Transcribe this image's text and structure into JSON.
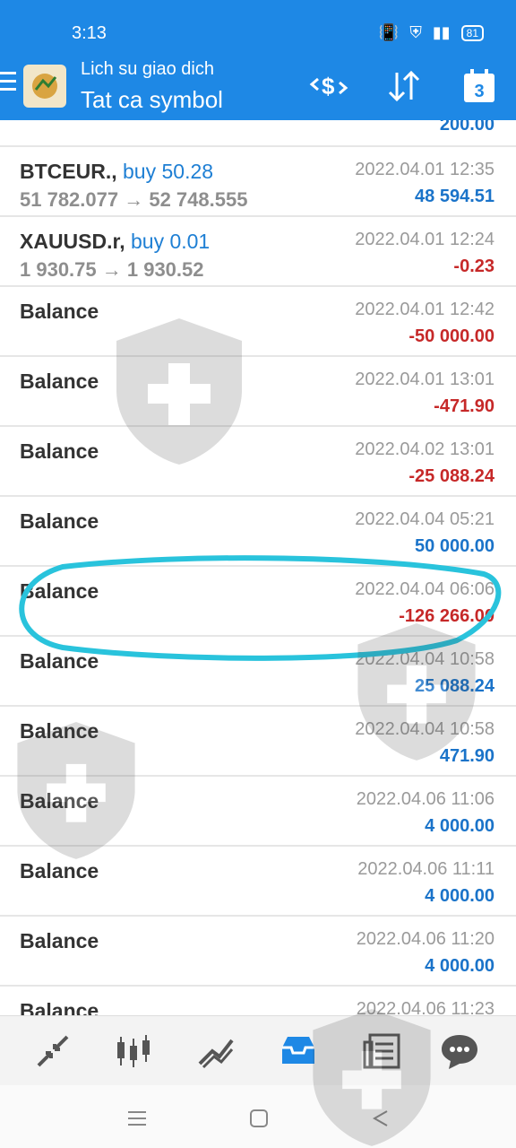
{
  "status": {
    "time": "3:13",
    "battery": "81"
  },
  "header": {
    "subtitle": "Lich su giao dich",
    "title": "Tat ca symbol",
    "calendar_day": "3"
  },
  "partial_top": {
    "amount": "200.00"
  },
  "trades": [
    {
      "symbol": "BTCEUR.,",
      "type": "buy 50.28",
      "prices": "51 782.077 → 52 748.555",
      "date": "2022.04.01 12:35",
      "amount": "48 594.51",
      "sign": "pos"
    },
    {
      "symbol": "XAUUSD.r,",
      "type": "buy 0.01",
      "prices": "1 930.75 → 1 930.52",
      "date": "2022.04.01 12:24",
      "amount": "-0.23",
      "sign": "neg"
    }
  ],
  "balances": [
    {
      "label": "Balance",
      "date": "2022.04.01 12:42",
      "amount": "-50 000.00",
      "sign": "neg"
    },
    {
      "label": "Balance",
      "date": "2022.04.01 13:01",
      "amount": "-471.90",
      "sign": "neg"
    },
    {
      "label": "Balance",
      "date": "2022.04.02 13:01",
      "amount": "-25 088.24",
      "sign": "neg"
    },
    {
      "label": "Balance",
      "date": "2022.04.04 05:21",
      "amount": "50 000.00",
      "sign": "pos"
    },
    {
      "label": "Balance",
      "date": "2022.04.04 06:06",
      "amount": "-126 266.00",
      "sign": "neg"
    },
    {
      "label": "Balance",
      "date": "2022.04.04 10:58",
      "amount": "25 088.24",
      "sign": "pos"
    },
    {
      "label": "Balance",
      "date": "2022.04.04 10:58",
      "amount": "471.90",
      "sign": "pos"
    },
    {
      "label": "Balance",
      "date": "2022.04.06 11:06",
      "amount": "4 000.00",
      "sign": "pos"
    },
    {
      "label": "Balance",
      "date": "2022.04.06 11:11",
      "amount": "4 000.00",
      "sign": "pos"
    },
    {
      "label": "Balance",
      "date": "2022.04.06 11:20",
      "amount": "4 000.00",
      "sign": "pos"
    },
    {
      "label": "Balance",
      "date": "2022.04.06 11:23",
      "amount": "",
      "sign": "pos"
    }
  ],
  "bottom_nav": [
    "quotes-icon",
    "chart-candles-icon",
    "trade-icon",
    "history-icon",
    "news-icon",
    "chat-icon"
  ],
  "colors": {
    "header": "#1e88e5",
    "positive": "#1a73c9",
    "negative": "#c62828",
    "highlight": "#29c3dc"
  }
}
